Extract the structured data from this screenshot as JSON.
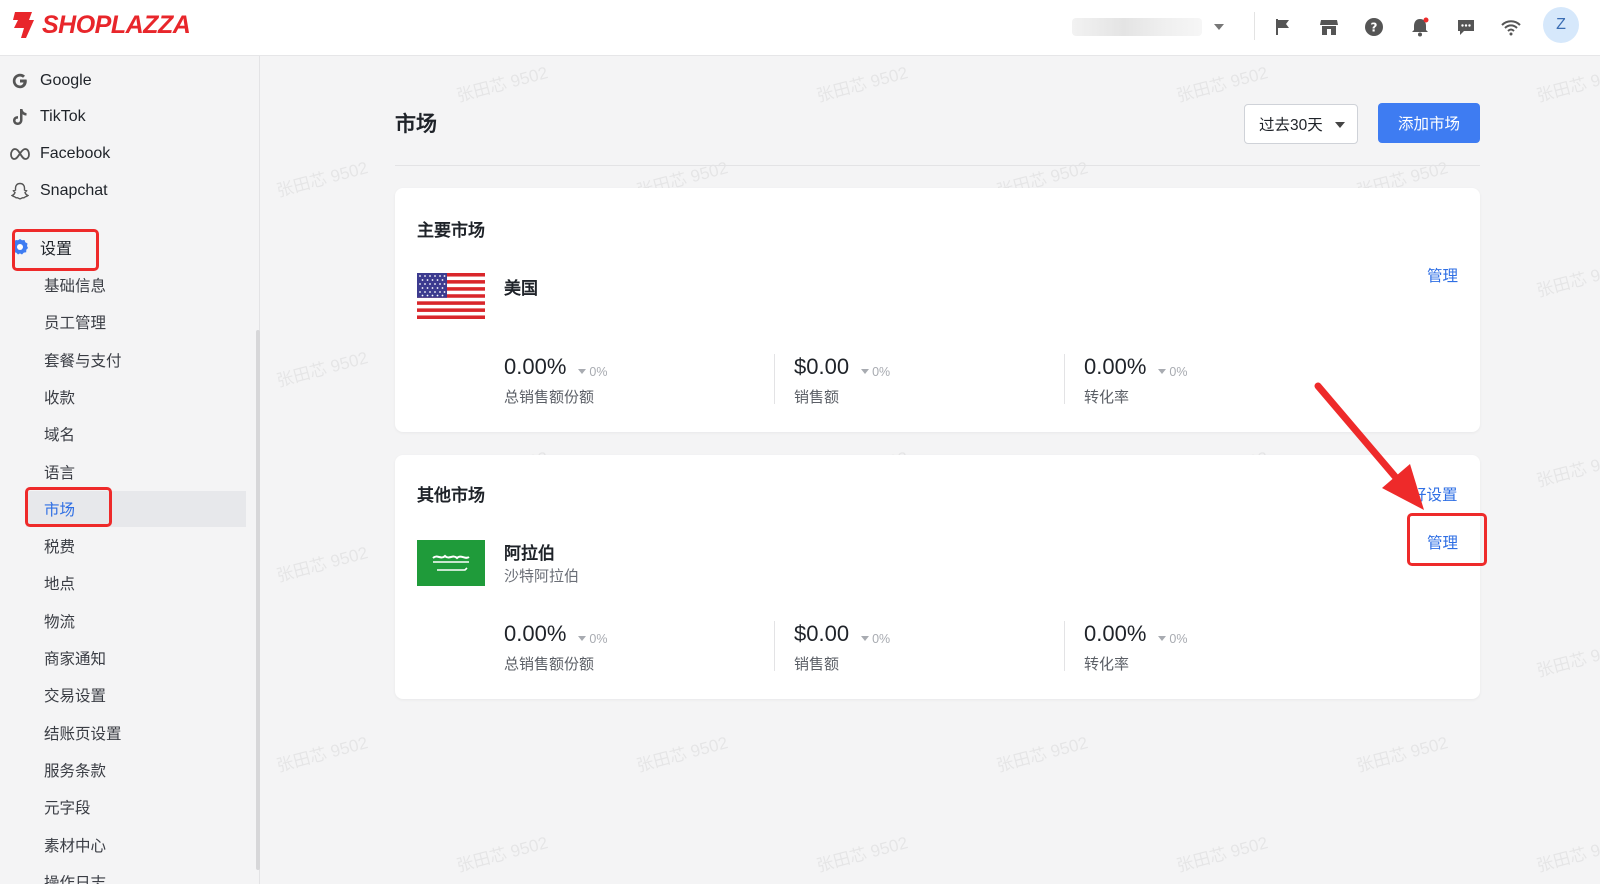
{
  "header": {
    "brand": "SHOPLAZZA",
    "avatar_letter": "Z",
    "icons": [
      "flag-icon",
      "store-icon",
      "help-icon",
      "bell-icon",
      "chat-icon",
      "wifi-icon"
    ]
  },
  "sidebar": {
    "channels": [
      {
        "label": "Google",
        "icon": "google-icon"
      },
      {
        "label": "TikTok",
        "icon": "tiktok-icon"
      },
      {
        "label": "Facebook",
        "icon": "meta-icon"
      },
      {
        "label": "Snapchat",
        "icon": "snapchat-icon"
      }
    ],
    "settings_label": "设置",
    "items": [
      {
        "label": "基础信息"
      },
      {
        "label": "员工管理"
      },
      {
        "label": "套餐与支付"
      },
      {
        "label": "收款"
      },
      {
        "label": "域名"
      },
      {
        "label": "语言"
      },
      {
        "label": "市场",
        "active": true
      },
      {
        "label": "税费"
      },
      {
        "label": "地点"
      },
      {
        "label": "物流"
      },
      {
        "label": "商家通知"
      },
      {
        "label": "交易设置"
      },
      {
        "label": "结账页设置"
      },
      {
        "label": "服务条款"
      },
      {
        "label": "元字段"
      },
      {
        "label": "素材中心"
      },
      {
        "label": "操作日志"
      }
    ]
  },
  "main": {
    "title": "市场",
    "date_range": "过去30天",
    "add_button": "添加市场",
    "primary": {
      "title": "主要市场",
      "manage": "管理",
      "market": {
        "name": "美国",
        "subtitle": ""
      },
      "metrics": [
        {
          "value": "0.00%",
          "change": "0%",
          "label": "总销售额份额"
        },
        {
          "value": "$0.00",
          "change": "0%",
          "label": "销售额"
        },
        {
          "value": "0.00%",
          "change": "0%",
          "label": "转化率"
        }
      ]
    },
    "other": {
      "title": "其他市场",
      "preferences": "好设置",
      "manage": "管理",
      "market": {
        "name": "阿拉伯",
        "subtitle": "沙特阿拉伯"
      },
      "metrics": [
        {
          "value": "0.00%",
          "change": "0%",
          "label": "总销售额份额"
        },
        {
          "value": "$0.00",
          "change": "0%",
          "label": "销售额"
        },
        {
          "value": "0.00%",
          "change": "0%",
          "label": "转化率"
        }
      ]
    }
  },
  "watermark": "张田芯 9502",
  "colors": {
    "brand": "#e8262b",
    "accent": "#3e7cf2",
    "highlight": "#ee2a2a"
  }
}
